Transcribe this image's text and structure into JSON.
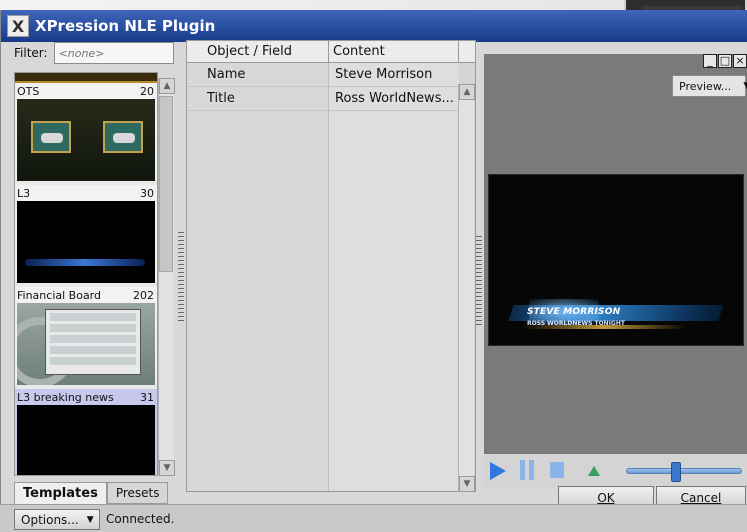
{
  "window": {
    "title": "XPression NLE Plugin"
  },
  "filter": {
    "label": "Filter:",
    "placeholder": "<none>"
  },
  "templates": [
    {
      "name": "OTS",
      "count": "20"
    },
    {
      "name": "L3",
      "count": "30"
    },
    {
      "name": "Financial Board",
      "count": "202"
    },
    {
      "name": "L3 breaking news",
      "count": "31"
    }
  ],
  "tabs": [
    {
      "label": "Templates"
    },
    {
      "label": "Presets"
    }
  ],
  "fields": {
    "headers": [
      "Object / Field",
      "Content"
    ],
    "rows": [
      {
        "field": "Name",
        "content": "Steve Morrison"
      },
      {
        "field": "Title",
        "content": "Ross WorldNews..."
      }
    ]
  },
  "preview": {
    "button_label": "Preview...",
    "lower_third_name": "STEVE MORRISON",
    "lower_third_title": "ROSS WORLDNEWS TONIGHT"
  },
  "transport": {
    "position": 0.42
  },
  "buttons": {
    "ok": "OK",
    "cancel": "Cancel"
  },
  "status": {
    "options_label": "Options...",
    "text": "Connected."
  },
  "colors": {
    "titlebar": "#2a4fa3",
    "selected_item": "#c8c8ec",
    "accent": "#2f78e0"
  }
}
